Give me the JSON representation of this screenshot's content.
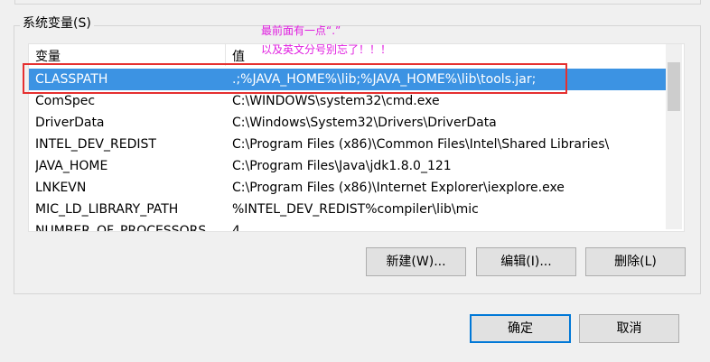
{
  "group": {
    "label": "系统变量(S)"
  },
  "annotation": {
    "line1": "最前面有一点“.”",
    "line2": "以及英文分号别忘了！！！"
  },
  "listview": {
    "columns": [
      "变量",
      "值"
    ],
    "rows": [
      {
        "name": "CLASSPATH",
        "value": ".;%JAVA_HOME%\\lib;%JAVA_HOME%\\lib\\tools.jar;",
        "selected": true
      },
      {
        "name": "ComSpec",
        "value": "C:\\WINDOWS\\system32\\cmd.exe"
      },
      {
        "name": "DriverData",
        "value": "C:\\Windows\\System32\\Drivers\\DriverData"
      },
      {
        "name": "INTEL_DEV_REDIST",
        "value": "C:\\Program Files (x86)\\Common Files\\Intel\\Shared Libraries\\"
      },
      {
        "name": "JAVA_HOME",
        "value": "C:\\Program Files\\Java\\jdk1.8.0_121"
      },
      {
        "name": "LNKEVN",
        "value": "C:\\Program Files (x86)\\Internet Explorer\\iexplore.exe"
      },
      {
        "name": "MIC_LD_LIBRARY_PATH",
        "value": "%INTEL_DEV_REDIST%compiler\\lib\\mic"
      },
      {
        "name": "NUMBER_OF_PROCESSORS",
        "value": "4"
      }
    ]
  },
  "buttons": {
    "new": "新建(W)...",
    "edit": "编辑(I)...",
    "delete": "删除(L)",
    "ok": "确定",
    "cancel": "取消"
  },
  "colors": {
    "selection": "#3c93e3",
    "highlight_box": "#e53030",
    "annotation_text": "#e020e0"
  }
}
